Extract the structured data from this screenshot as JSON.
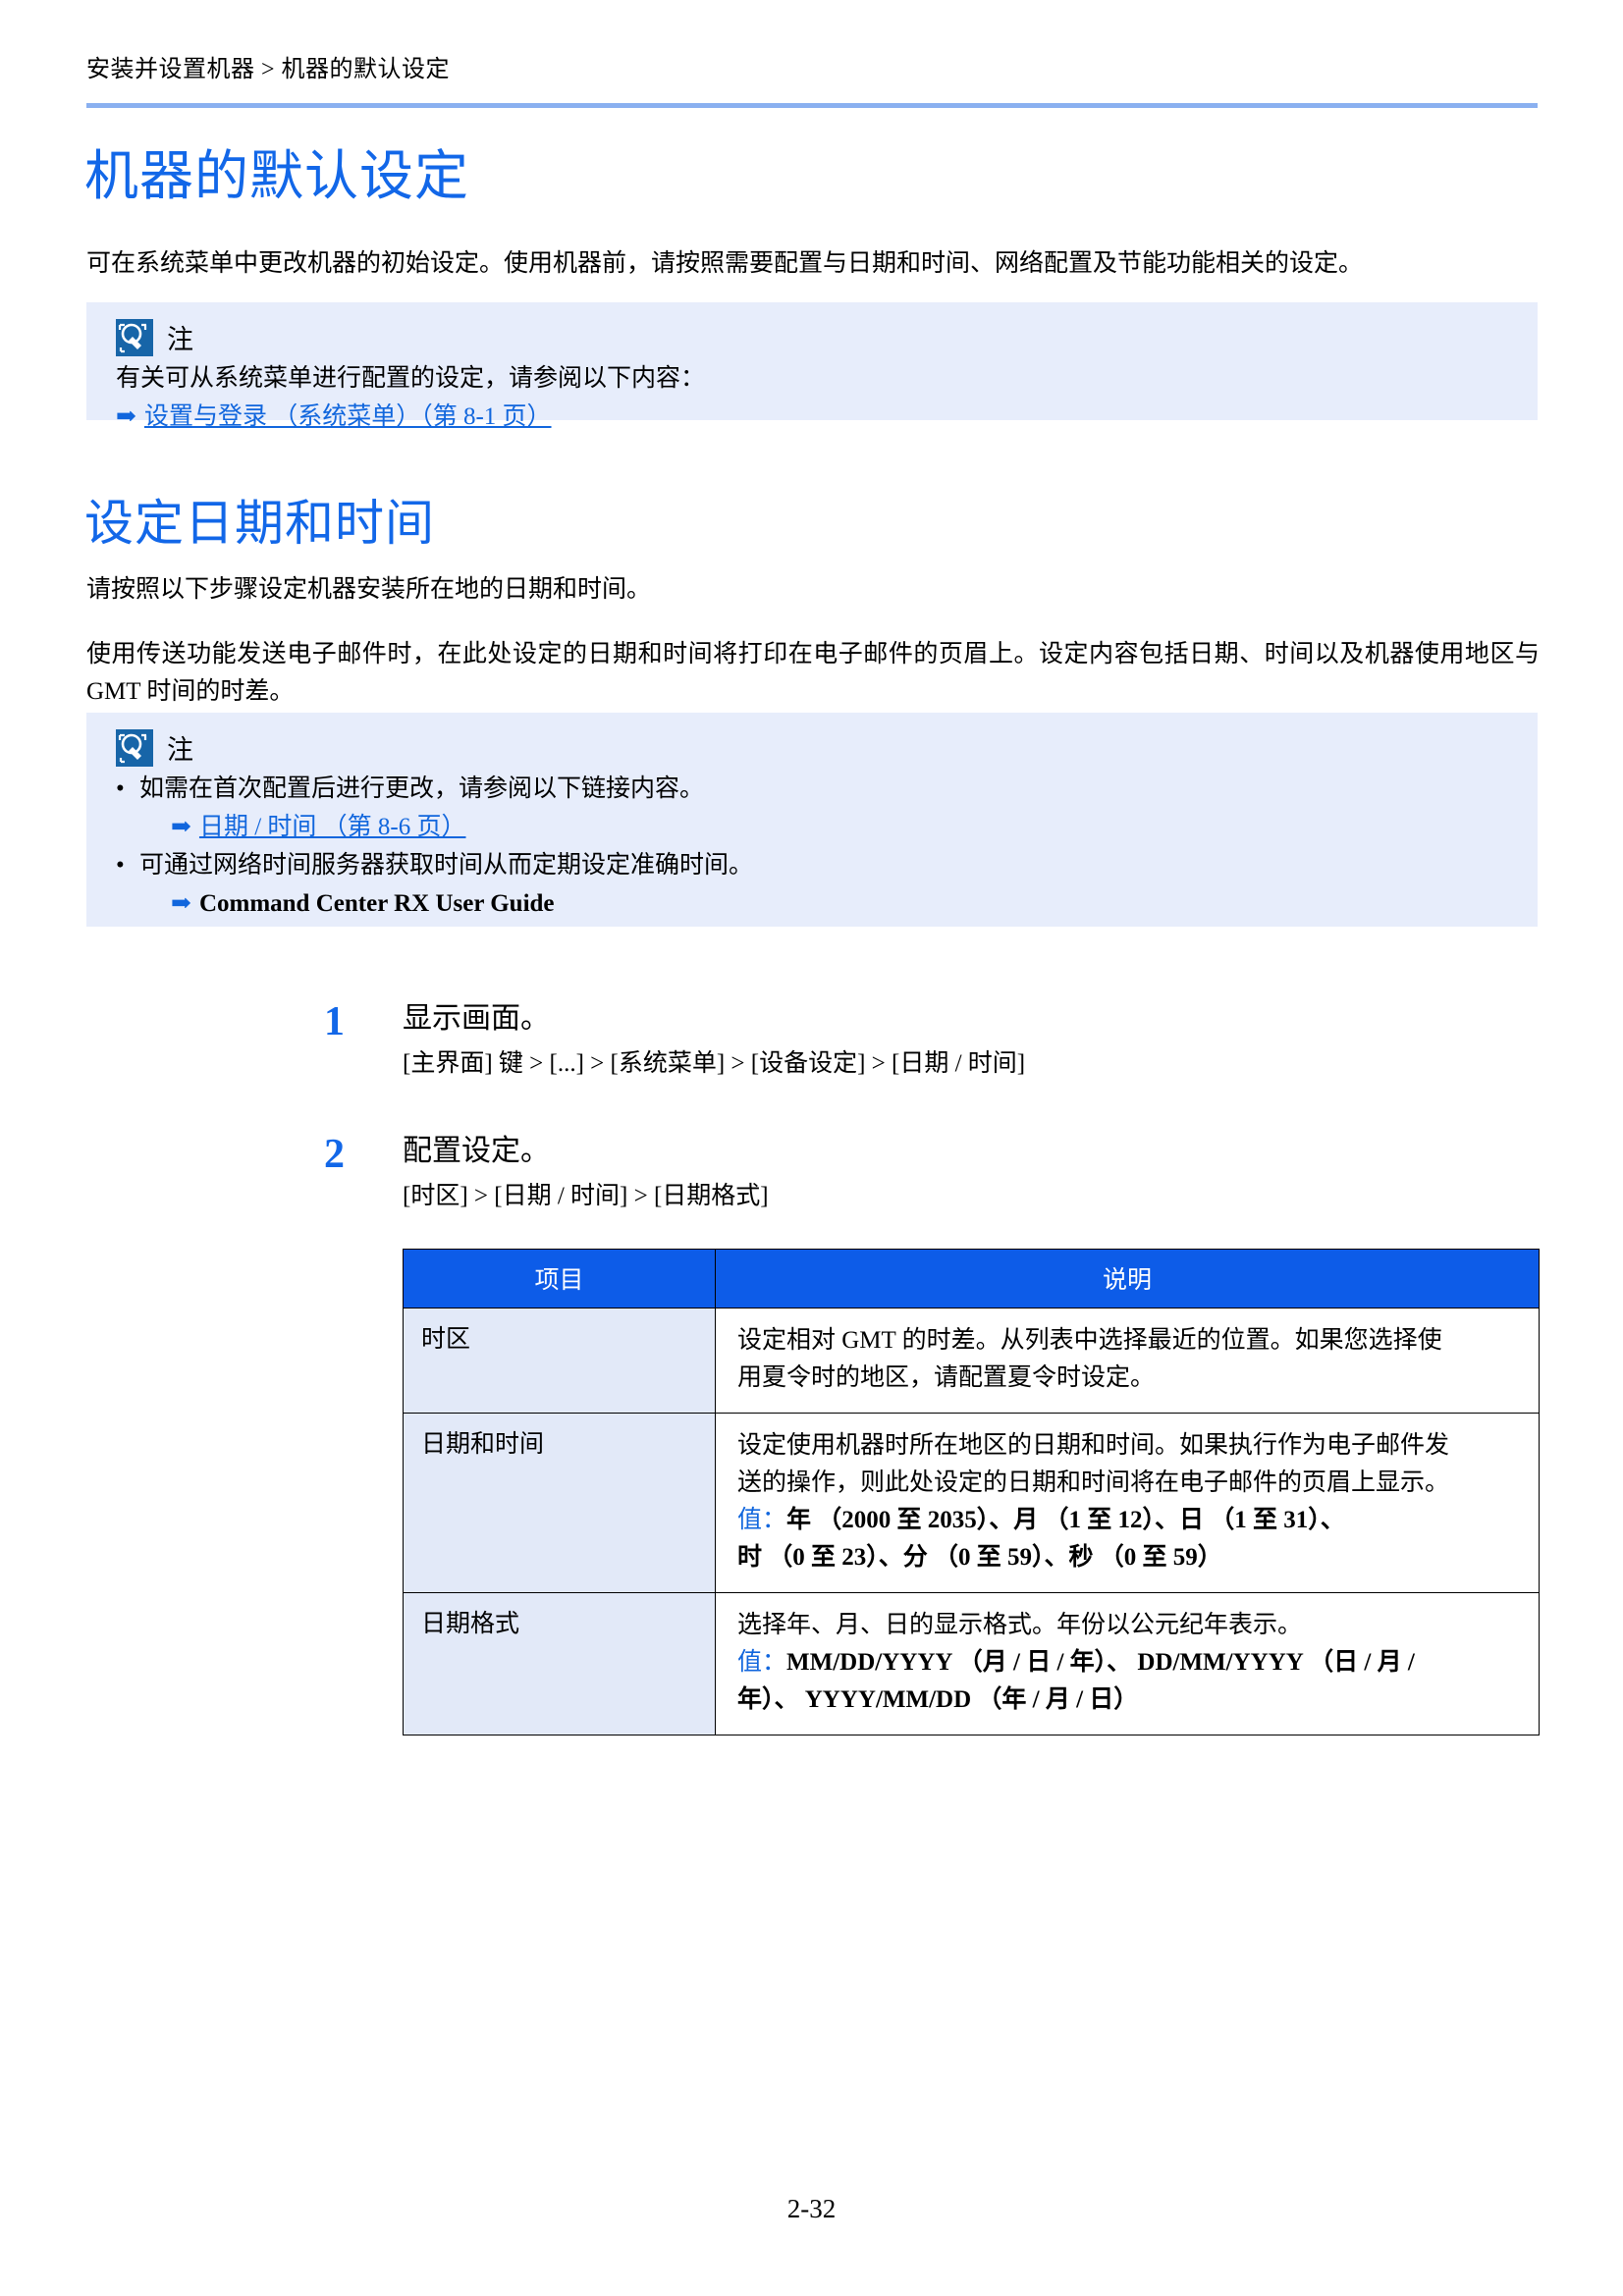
{
  "header": {
    "breadcrumb": "安装并设置机器 > 机器的默认设定"
  },
  "title_main": "机器的默认设定",
  "intro_paragraph": "可在系统菜单中更改机器的初始设定。使用机器前，请按照需要配置与日期和时间、网络配置及节能功能相关的设定。",
  "note1": {
    "label": "注",
    "icon": "note-lightbulb-icon",
    "text": "有关可从系统菜单进行配置的设定，请参阅以下内容：",
    "link": "设置与登录 （系统菜单）（第 8-1 页）",
    "arrow": "➡"
  },
  "title_datetime": "设定日期和时间",
  "para1": "请按照以下步骤设定机器安装所在地的日期和时间。",
  "para2": "使用传送功能发送电子邮件时，在此处设定的日期和时间将打印在电子邮件的页眉上。设定内容包括日期、时间以及机器使用地区与 GMT 时间的时差。",
  "note2": {
    "label": "注",
    "icon": "note-lightbulb-icon",
    "bullet1": "如需在首次配置后进行更改，请参阅以下链接内容。",
    "bullet1_link": "日期 / 时间 （第 8-6 页）",
    "bullet2": "可通过网络时间服务器获取时间从而定期设定准确时间。",
    "bullet2_link": "Command Center RX User Guide",
    "bullet_mark": "•",
    "arrow": "➡"
  },
  "steps": [
    {
      "number": "1",
      "title": "显示画面。",
      "detail": "[主界面] 键 > [...] > [系统菜单] > [设备设定] > [日期 / 时间]"
    },
    {
      "number": "2",
      "title": "配置设定。",
      "detail": "[时区] > [日期 / 时间] > [日期格式]"
    }
  ],
  "table": {
    "headers": [
      "项目",
      "说明"
    ],
    "rows": [
      {
        "item": "时区",
        "description_lines": [
          "设定相对 GMT 的时差。从列表中选择最近的位置。如果您选择使",
          "用夏令时的地区，请配置夏令时设定。"
        ],
        "value_label": "",
        "value_lines": []
      },
      {
        "item": "日期和时间",
        "description_lines": [
          "设定使用机器时所在地区的日期和时间。如果执行作为电子邮件发",
          "送的操作，则此处设定的日期和时间将在电子邮件的页眉上显示。"
        ],
        "value_label": "值：",
        "value_lines": [
          "年 （2000 至 2035）、月 （1 至 12）、日 （1 至 31）、",
          "时 （0 至 23）、分 （0 至 59）、秒 （0 至 59）"
        ]
      },
      {
        "item": "日期格式",
        "description_lines": [
          "选择年、月、日的显示格式。年份以公元纪年表示。"
        ],
        "value_label": "值：",
        "value_lines": [
          "MM/DD/YYYY （月 / 日 / 年）、 DD/MM/YYYY （日 / 月 /",
          "年）、 YYYY/MM/DD （年 / 月 / 日）"
        ]
      }
    ]
  },
  "footer": {
    "page_number": "2-32"
  }
}
